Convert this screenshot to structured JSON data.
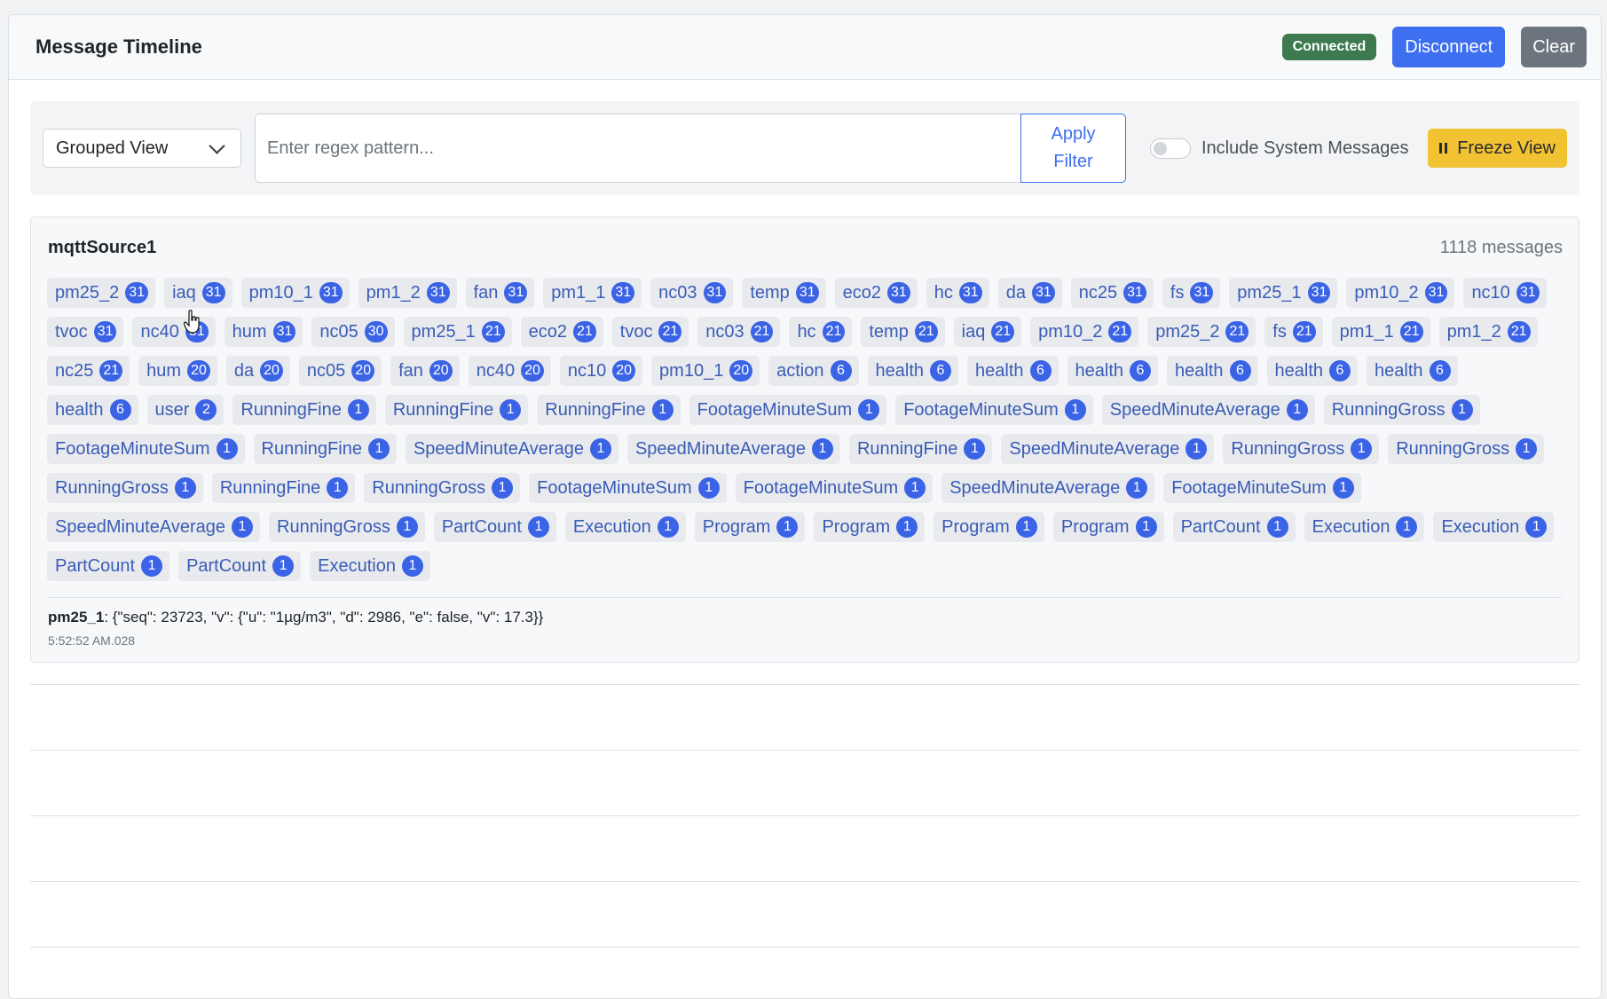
{
  "header": {
    "title": "Message Timeline",
    "status": "Connected",
    "disconnect_label": "Disconnect",
    "clear_label": "Clear"
  },
  "controls": {
    "view_select": "Grouped View",
    "regex_placeholder": "Enter regex pattern...",
    "apply_label": "Apply Filter",
    "system_toggle_label": "Include System Messages",
    "system_toggle_on": false,
    "freeze_label": "Freeze View"
  },
  "source": {
    "name": "mqttSource1",
    "count_label": "1118 messages",
    "tags": [
      {
        "label": "pm25_2",
        "count": "31"
      },
      {
        "label": "iaq",
        "count": "31"
      },
      {
        "label": "pm10_1",
        "count": "31"
      },
      {
        "label": "pm1_2",
        "count": "31"
      },
      {
        "label": "fan",
        "count": "31"
      },
      {
        "label": "pm1_1",
        "count": "31"
      },
      {
        "label": "nc03",
        "count": "31"
      },
      {
        "label": "temp",
        "count": "31"
      },
      {
        "label": "eco2",
        "count": "31"
      },
      {
        "label": "hc",
        "count": "31"
      },
      {
        "label": "da",
        "count": "31"
      },
      {
        "label": "nc25",
        "count": "31"
      },
      {
        "label": "fs",
        "count": "31"
      },
      {
        "label": "pm25_1",
        "count": "31"
      },
      {
        "label": "pm10_2",
        "count": "31"
      },
      {
        "label": "nc10",
        "count": "31"
      },
      {
        "label": "tvoc",
        "count": "31"
      },
      {
        "label": "nc40",
        "count": "31"
      },
      {
        "label": "hum",
        "count": "31"
      },
      {
        "label": "nc05",
        "count": "30"
      },
      {
        "label": "pm25_1",
        "count": "21"
      },
      {
        "label": "eco2",
        "count": "21"
      },
      {
        "label": "tvoc",
        "count": "21"
      },
      {
        "label": "nc03",
        "count": "21"
      },
      {
        "label": "hc",
        "count": "21"
      },
      {
        "label": "temp",
        "count": "21"
      },
      {
        "label": "iaq",
        "count": "21"
      },
      {
        "label": "pm10_2",
        "count": "21"
      },
      {
        "label": "pm25_2",
        "count": "21"
      },
      {
        "label": "fs",
        "count": "21"
      },
      {
        "label": "pm1_1",
        "count": "21"
      },
      {
        "label": "pm1_2",
        "count": "21"
      },
      {
        "label": "nc25",
        "count": "21"
      },
      {
        "label": "hum",
        "count": "20"
      },
      {
        "label": "da",
        "count": "20"
      },
      {
        "label": "nc05",
        "count": "20"
      },
      {
        "label": "fan",
        "count": "20"
      },
      {
        "label": "nc40",
        "count": "20"
      },
      {
        "label": "nc10",
        "count": "20"
      },
      {
        "label": "pm10_1",
        "count": "20"
      },
      {
        "label": "action",
        "count": "6"
      },
      {
        "label": "health",
        "count": "6"
      },
      {
        "label": "health",
        "count": "6"
      },
      {
        "label": "health",
        "count": "6"
      },
      {
        "label": "health",
        "count": "6"
      },
      {
        "label": "health",
        "count": "6"
      },
      {
        "label": "health",
        "count": "6"
      },
      {
        "label": "health",
        "count": "6"
      },
      {
        "label": "user",
        "count": "2"
      },
      {
        "label": "RunningFine",
        "count": "1"
      },
      {
        "label": "RunningFine",
        "count": "1"
      },
      {
        "label": "RunningFine",
        "count": "1"
      },
      {
        "label": "FootageMinuteSum",
        "count": "1"
      },
      {
        "label": "FootageMinuteSum",
        "count": "1"
      },
      {
        "label": "SpeedMinuteAverage",
        "count": "1"
      },
      {
        "label": "RunningGross",
        "count": "1"
      },
      {
        "label": "FootageMinuteSum",
        "count": "1"
      },
      {
        "label": "RunningFine",
        "count": "1"
      },
      {
        "label": "SpeedMinuteAverage",
        "count": "1"
      },
      {
        "label": "SpeedMinuteAverage",
        "count": "1"
      },
      {
        "label": "RunningFine",
        "count": "1"
      },
      {
        "label": "SpeedMinuteAverage",
        "count": "1"
      },
      {
        "label": "RunningGross",
        "count": "1"
      },
      {
        "label": "RunningGross",
        "count": "1"
      },
      {
        "label": "RunningGross",
        "count": "1"
      },
      {
        "label": "RunningFine",
        "count": "1"
      },
      {
        "label": "RunningGross",
        "count": "1"
      },
      {
        "label": "FootageMinuteSum",
        "count": "1"
      },
      {
        "label": "FootageMinuteSum",
        "count": "1"
      },
      {
        "label": "SpeedMinuteAverage",
        "count": "1"
      },
      {
        "label": "FootageMinuteSum",
        "count": "1"
      },
      {
        "label": "SpeedMinuteAverage",
        "count": "1"
      },
      {
        "label": "RunningGross",
        "count": "1"
      },
      {
        "label": "PartCount",
        "count": "1"
      },
      {
        "label": "Execution",
        "count": "1"
      },
      {
        "label": "Program",
        "count": "1"
      },
      {
        "label": "Program",
        "count": "1"
      },
      {
        "label": "Program",
        "count": "1"
      },
      {
        "label": "Program",
        "count": "1"
      },
      {
        "label": "PartCount",
        "count": "1"
      },
      {
        "label": "Execution",
        "count": "1"
      },
      {
        "label": "Execution",
        "count": "1"
      },
      {
        "label": "PartCount",
        "count": "1"
      },
      {
        "label": "PartCount",
        "count": "1"
      },
      {
        "label": "Execution",
        "count": "1"
      }
    ],
    "last_message": {
      "topic": "pm25_1",
      "payload": ": {\"seq\": 23723, \"v\": {\"u\": \"1µg/m3\", \"d\": 2986, \"e\": false, \"v\": 17.3}}",
      "time": "5:52:52 AM.028"
    }
  },
  "colors": {
    "primary": "#3d6ff0",
    "connected": "#3d7a4f",
    "freeze": "#f1c232",
    "clear": "#6c757d",
    "tag_text": "#3a5cb6",
    "tag_badge": "#3a63e6"
  }
}
